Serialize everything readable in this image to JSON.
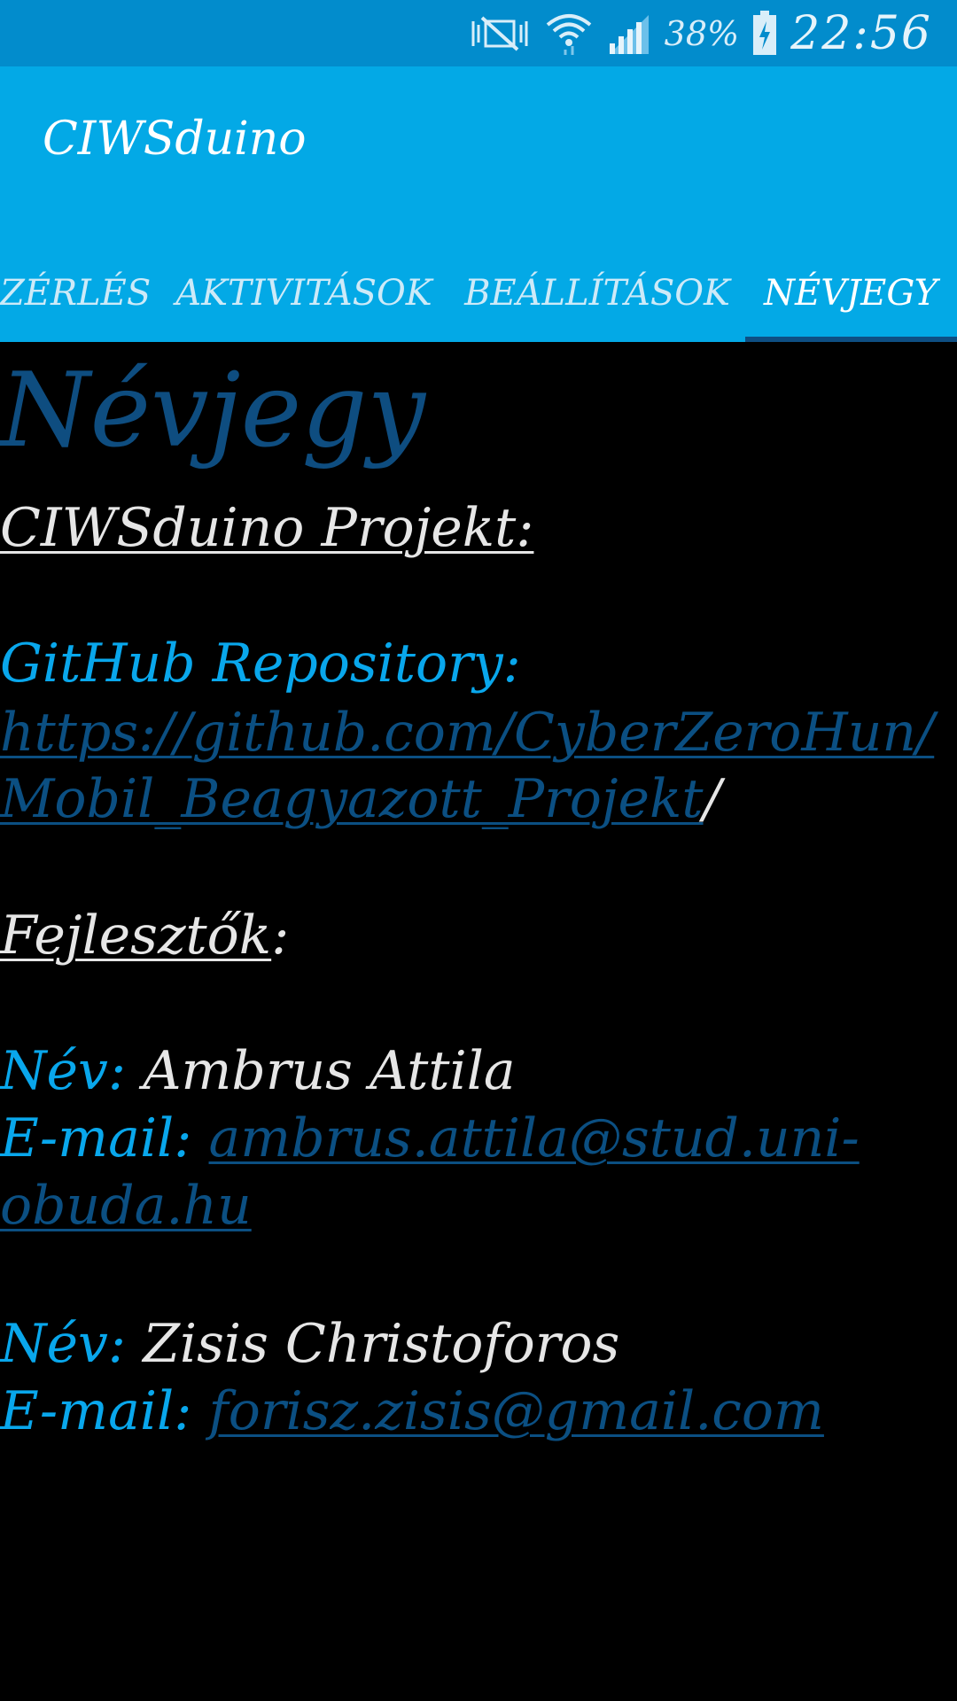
{
  "status_bar": {
    "battery_percent": "38%",
    "time": "22:56",
    "icons": [
      "vibrate-mute-icon",
      "wifi-icon",
      "signal-icon",
      "battery-charging-icon"
    ]
  },
  "app_bar": {
    "title": "CIWSduino",
    "tabs": [
      {
        "label": "ZÉRLÉS"
      },
      {
        "label": "AKTIVITÁSOK"
      },
      {
        "label": "BEÁLLÍTÁSOK"
      },
      {
        "label": "NÉVJEGY"
      }
    ],
    "active_tab_index": 3
  },
  "content": {
    "heading": "Névjegy",
    "project_label": "CIWSduino Projekt:",
    "repo_label": "GitHub Repository:",
    "repo_url_line1": "https://github.com/CyberZeroHun/",
    "repo_url_line2": "Mobil_Beagyazott_Projekt",
    "repo_url_trailing": "/",
    "developers_label": "Fejlesztők",
    "developers_colon": ":",
    "developers": [
      {
        "name_label": "Név:",
        "name": "Ambrus Attila",
        "email_label": "E-mail:",
        "email_line1": "ambrus.attila@stud.uni-",
        "email_line2": "obuda.hu"
      },
      {
        "name_label": "Név:",
        "name": "Zisis Christoforos",
        "email_label": "E-mail:",
        "email_line1": "forisz.zisis@gmail.com"
      }
    ]
  },
  "colors": {
    "status_bar": "#028ccc",
    "app_bar": "#03a9e6",
    "heading": "#0e4d80",
    "label_blue": "#09a7ec",
    "link": "#0b4f82",
    "background": "#000000"
  }
}
